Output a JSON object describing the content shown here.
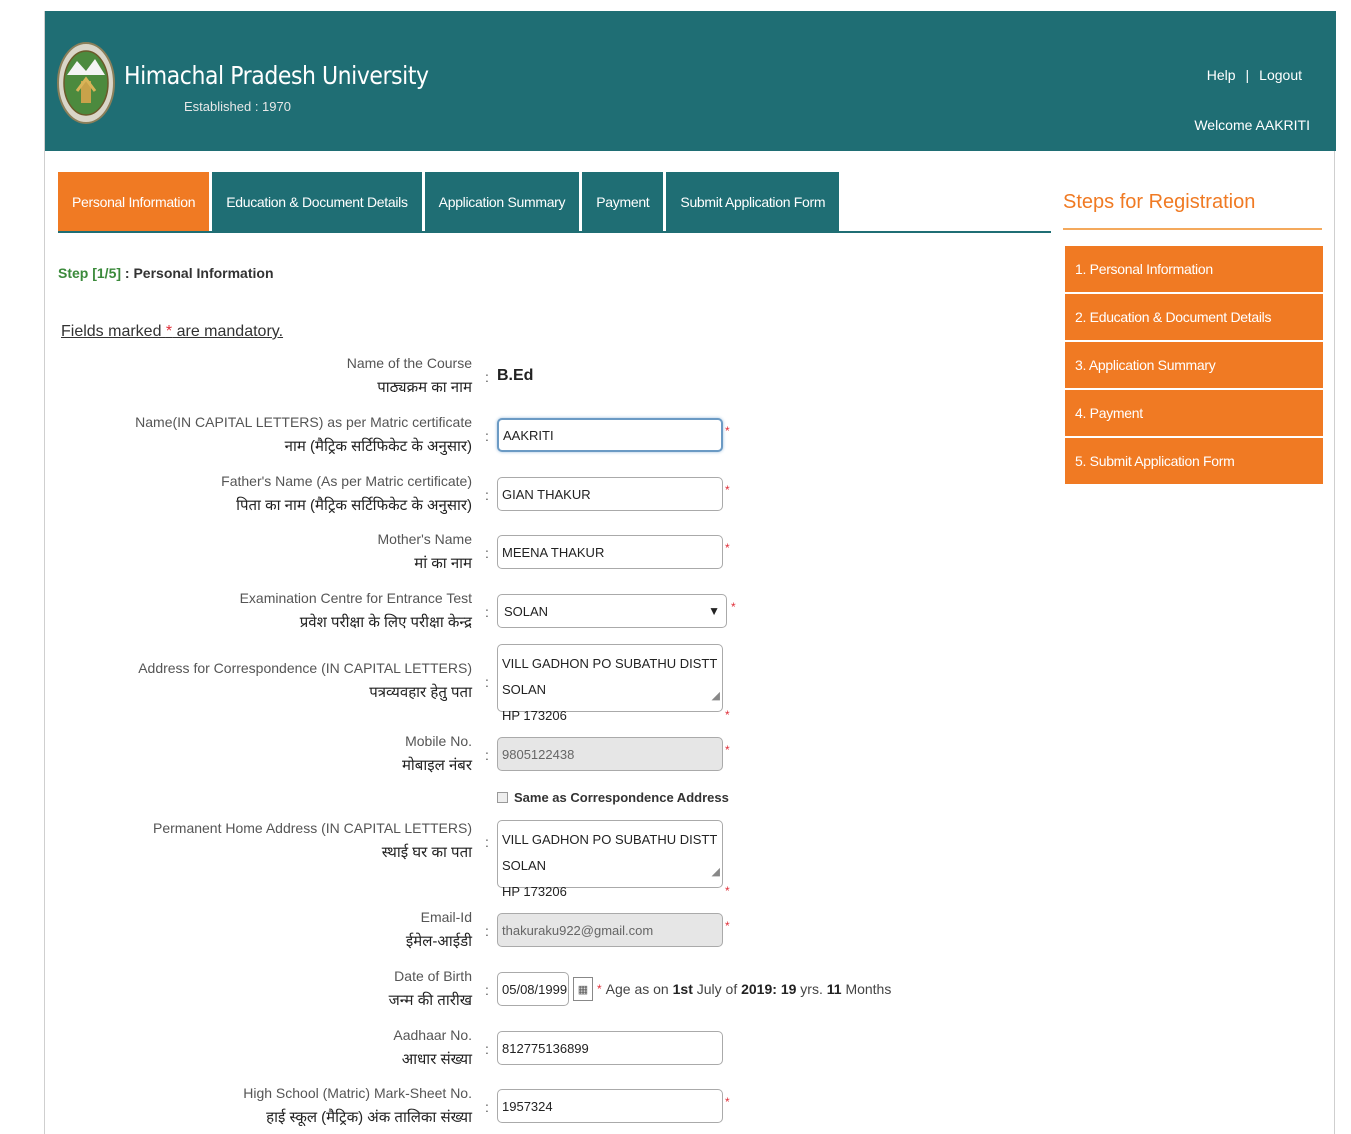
{
  "header": {
    "university_name": "Himachal Pradesh University",
    "established": "Established : 1970",
    "help_label": "Help",
    "separator": "|",
    "logout_label": "Logout",
    "welcome": "Welcome AAKRITI",
    "bg_color": "#1f6e74"
  },
  "tabs": [
    {
      "label": "Personal Information",
      "active": true
    },
    {
      "label": "Education & Document Details",
      "active": false
    },
    {
      "label": "Application Summary",
      "active": false
    },
    {
      "label": "Payment",
      "active": false
    },
    {
      "label": "Submit Application Form",
      "active": false
    }
  ],
  "step": {
    "number": "Step [1/5]",
    "separator": " : ",
    "title": "Personal Information"
  },
  "mandatory": {
    "prefix": "Fields marked ",
    "star": "*",
    "suffix": " are mandatory."
  },
  "form": {
    "course": {
      "label_en": "Name of the Course",
      "label_hi": "पाठ्यक्रम का नाम",
      "value": "B.Ed"
    },
    "name": {
      "label_en": "Name(IN CAPITAL LETTERS) as per Matric certificate",
      "label_hi": "नाम (मैट्रिक सर्टिफिकेट के अनुसार)",
      "value": "AAKRITI"
    },
    "father": {
      "label_en": "Father's Name (As per Matric certificate)",
      "label_hi": "पिता का नाम (मैट्रिक सर्टिफिकेट के अनुसार)",
      "value": "GIAN THAKUR"
    },
    "mother": {
      "label_en": "Mother's Name",
      "label_hi": "मां का नाम",
      "value": "MEENA THAKUR"
    },
    "exam_centre": {
      "label_en": "Examination Centre for Entrance Test",
      "label_hi": "प्रवेश परीक्षा के लिए परीक्षा केन्द्र",
      "value": "SOLAN"
    },
    "correspondence": {
      "label_en": "Address for Correspondence (IN CAPITAL LETTERS)",
      "label_hi": "पत्रव्यवहार हेतु पता",
      "line1": "VILL GADHON PO SUBATHU DISTT SOLAN",
      "line2": "HP 173206"
    },
    "mobile": {
      "label_en": "Mobile No.",
      "label_hi": "मोबाइल नंबर",
      "value": "9805122438"
    },
    "same_address": {
      "label": "Same as Correspondence Address",
      "checked": false
    },
    "permanent": {
      "label_en": "Permanent Home Address (IN CAPITAL LETTERS)",
      "label_hi": "स्थाई घर का पता",
      "line1": "VILL GADHON PO SUBATHU DISTT SOLAN",
      "line2": "HP 173206"
    },
    "email": {
      "label_en": "Email-Id",
      "label_hi": "ईमेल-आईडी",
      "value": "thakuraku922@gmail.com"
    },
    "dob": {
      "label_en": "Date of Birth",
      "label_hi": "जन्म की तारीख",
      "value": "05/08/1999",
      "age_prefix": "Age as on",
      "age_date": "1st",
      "age_month": "July of",
      "age_year": "2019:",
      "age_years": "19",
      "yrs": "yrs.",
      "age_months": "11",
      "months": "Months"
    },
    "aadhaar": {
      "label_en": "Aadhaar No.",
      "label_hi": "आधार संख्या",
      "value": "812775136899"
    },
    "matric": {
      "label_en": "High School (Matric) Mark-Sheet No.",
      "label_hi": "हाई स्कूल (मैट्रिक) अंक तालिका संख्या",
      "value": "1957324"
    },
    "colon": ":",
    "required_mark": "*"
  },
  "sidebar": {
    "title": "Steps for Registration",
    "items": [
      "1. Personal Information",
      "2. Education & Document Details",
      "3. Application Summary",
      "4. Payment",
      "5. Submit Application Form"
    ],
    "accent_color": "#f07a23"
  }
}
